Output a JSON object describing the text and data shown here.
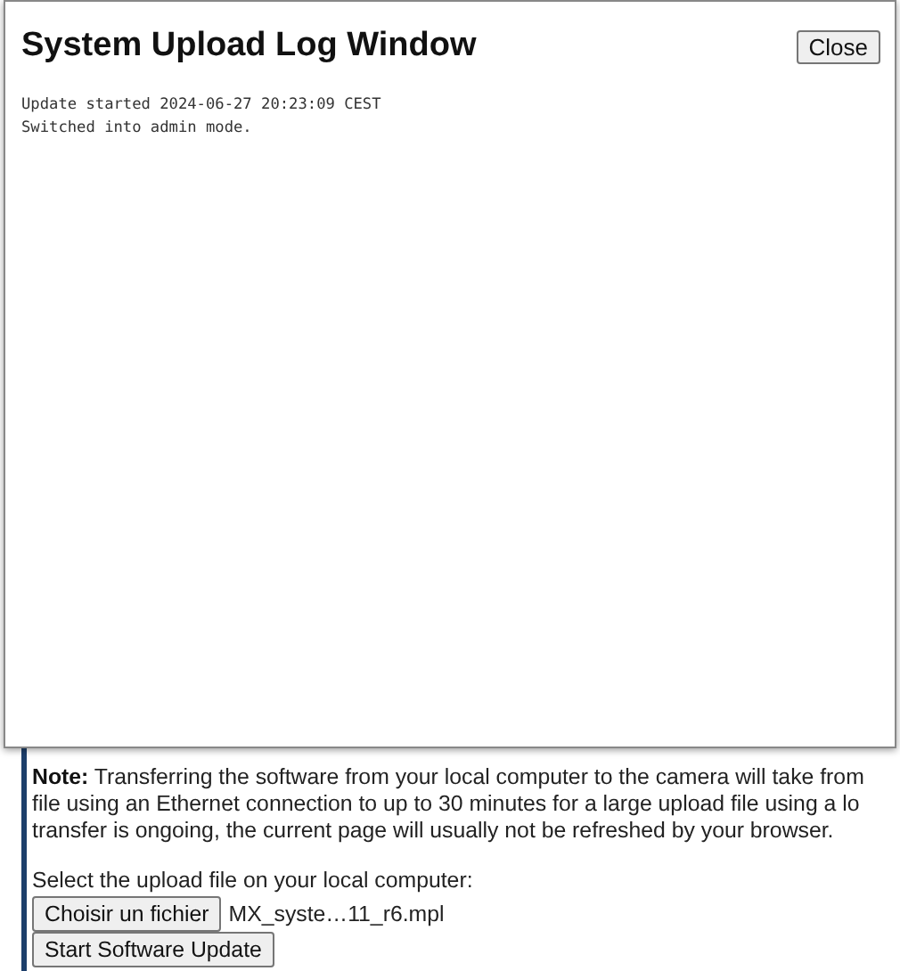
{
  "log_window": {
    "title": "System Upload Log Window",
    "close_button": "Close",
    "log_lines": [
      "Update started 2024-06-27 20:23:09 CEST",
      "Switched into admin mode."
    ]
  },
  "update_section": {
    "note_label": "Note:",
    "note_lines": [
      "Transferring the software from your local computer to the camera will take from",
      "file using an Ethernet connection to up to 30 minutes for a large upload file using a lo",
      "transfer is ongoing, the current page will usually not be refreshed by your browser."
    ],
    "select_label": "Select the upload file on your local computer:",
    "file_button": "Choisir un fichier",
    "file_name": "MX_syste…11_r6.mpl",
    "start_button": "Start Software Update"
  }
}
